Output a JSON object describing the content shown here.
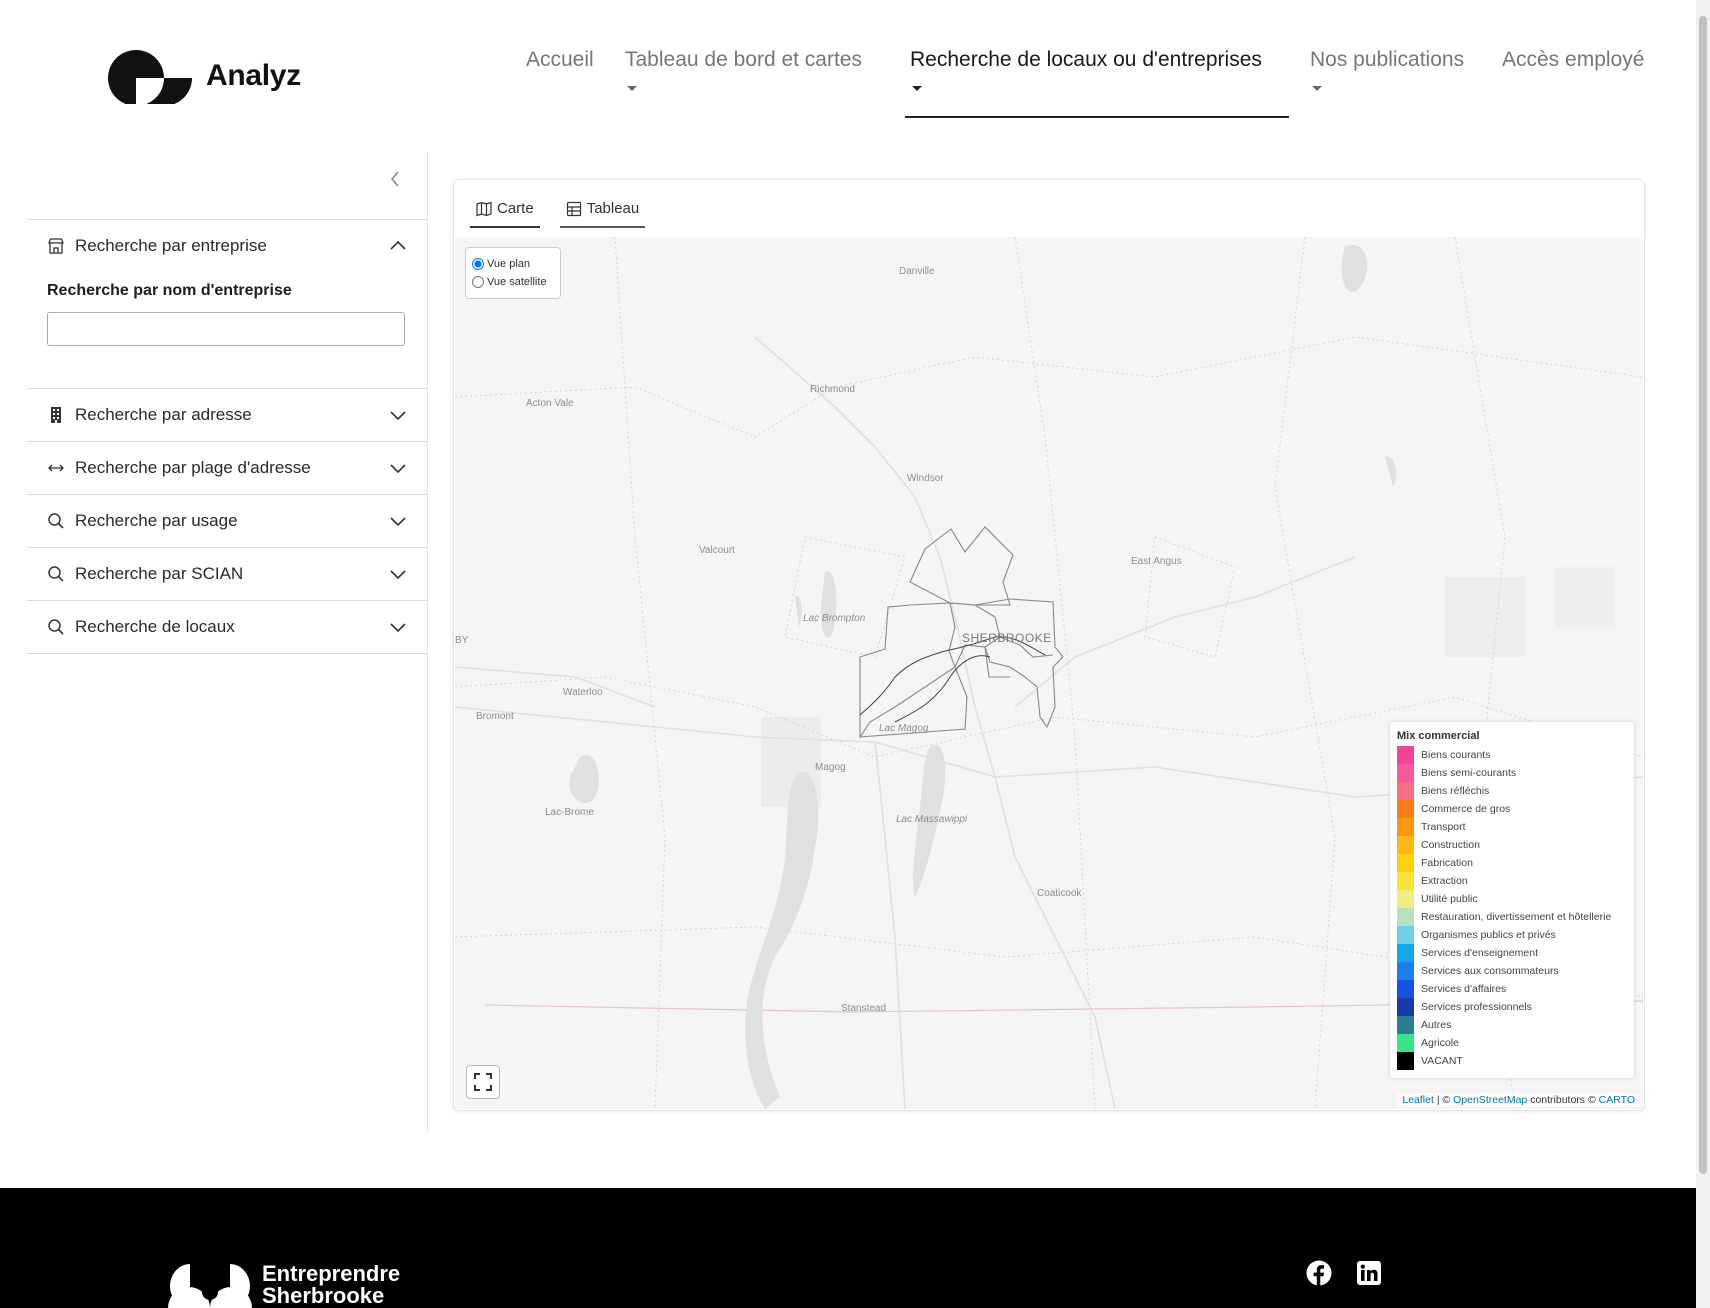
{
  "header": {
    "brand": "Analyz",
    "nav": [
      {
        "label": "Accueil"
      },
      {
        "label": "Tableau de bord et cartes"
      },
      {
        "label": "Recherche de locaux ou d'entreprises"
      },
      {
        "label": "Nos publications"
      },
      {
        "label": "Accès employé"
      }
    ]
  },
  "sidebar": {
    "collapse_icon": "chevron-left-icon",
    "sections": [
      {
        "label": "Recherche par entreprise",
        "icon": "store-icon",
        "expanded": true,
        "field_label": "Recherche par nom d'entreprise",
        "field_value": ""
      },
      {
        "label": "Recherche par adresse",
        "icon": "building-icon"
      },
      {
        "label": "Recherche par plage d'adresse",
        "icon": "arrows-horizontal-icon"
      },
      {
        "label": "Recherche par usage",
        "icon": "search-icon"
      },
      {
        "label": "Recherche par SCIAN",
        "icon": "search-icon"
      },
      {
        "label": "Recherche de locaux",
        "icon": "search-icon"
      }
    ]
  },
  "tabs": [
    {
      "label": "Carte",
      "icon": "map-icon",
      "active": true
    },
    {
      "label": "Tableau",
      "icon": "table-icon",
      "active": false
    }
  ],
  "map": {
    "layer_options": [
      "Vue plan",
      "Vue satellite"
    ],
    "selected_layer": "Vue plan",
    "places": {
      "danville": "Danville",
      "richmond": "Richmond",
      "acton_vale": "Acton Vale",
      "windsor": "Windsor",
      "valcourt": "Valcourt",
      "east_angus": "East Angus",
      "lac_brompton": "Lac Brompton",
      "sherbrooke": "SHERBROOKE",
      "by": "BY",
      "waterloo": "Waterloo",
      "bromont": "Bromont",
      "lac_magog": "Lac Magog",
      "magog": "Magog",
      "lac_brome": "Lac-Brome",
      "lac_massawippi": "Lac Massawippi",
      "coaticook": "Coaticook",
      "stanstead": "Stanstead"
    },
    "legend": {
      "title": "Mix commercial",
      "items": [
        {
          "label": "Biens courants",
          "color": "#f2449a"
        },
        {
          "label": "Biens semi-courants",
          "color": "#f55a9e"
        },
        {
          "label": "Biens réfléchis",
          "color": "#f76f86"
        },
        {
          "label": "Commerce de gros",
          "color": "#f97b1c"
        },
        {
          "label": "Transport",
          "color": "#fb9a12"
        },
        {
          "label": "Construction",
          "color": "#fdb812"
        },
        {
          "label": "Fabrication",
          "color": "#fdd00f"
        },
        {
          "label": "Extraction",
          "color": "#f9e23a"
        },
        {
          "label": "Utilité public",
          "color": "#f2ea84"
        },
        {
          "label": "Restauration, divertissement et hôtellerie",
          "color": "#b7dfc0"
        },
        {
          "label": "Organismes publics et privés",
          "color": "#6fcde6"
        },
        {
          "label": "Services d'enseignement",
          "color": "#15a7e3"
        },
        {
          "label": "Services aux consommateurs",
          "color": "#1d7fe8"
        },
        {
          "label": "Services d'affaires",
          "color": "#1653e0"
        },
        {
          "label": "Services professionnels",
          "color": "#1b3aa8"
        },
        {
          "label": "Autres",
          "color": "#2c7e93"
        },
        {
          "label": "Agricole",
          "color": "#3be38c"
        },
        {
          "label": "VACANT",
          "color": "#000000"
        }
      ]
    },
    "attribution": {
      "leaflet": "Leaflet",
      "sep": " | © ",
      "osm": "OpenStreetMap",
      "contrib": " contributors © ",
      "carto": "CARTO"
    }
  },
  "footer": {
    "brand_line1": "Entreprendre",
    "brand_line2": "Sherbrooke",
    "social": [
      "facebook-icon",
      "linkedin-icon"
    ]
  }
}
